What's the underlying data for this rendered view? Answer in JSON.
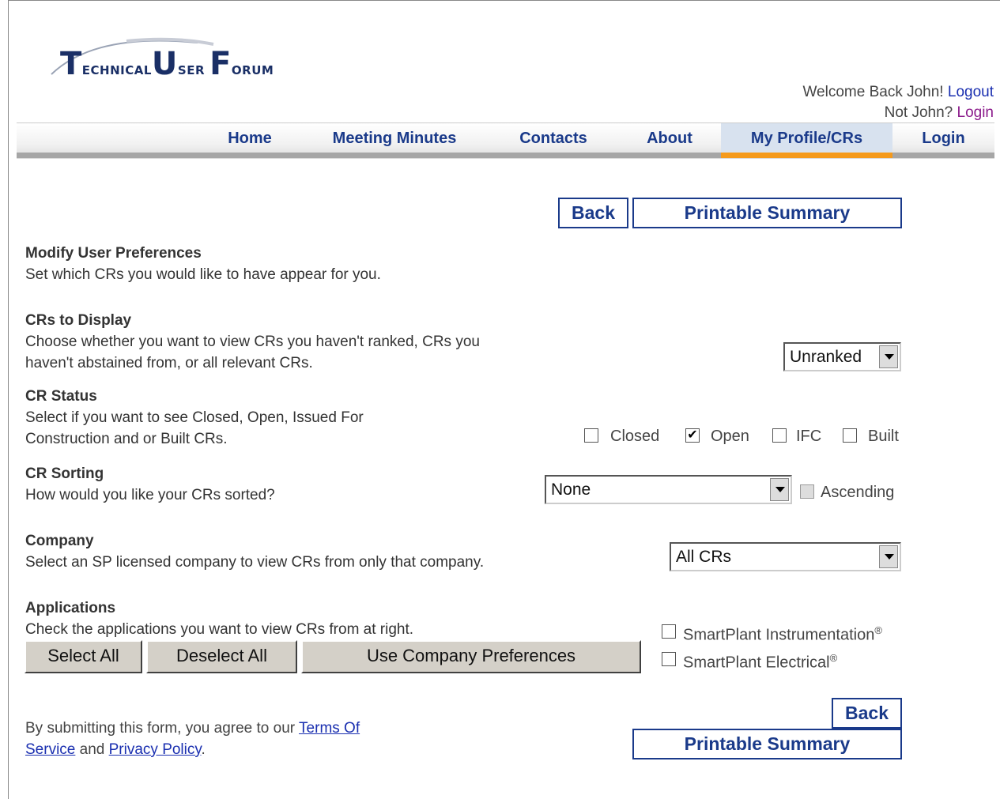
{
  "logo": {
    "text": "TECHNICAL USER FORUM",
    "t": "T",
    "t_rest": "ECHNICAL",
    "u": "U",
    "u_rest": "SER",
    "f": "F",
    "f_rest": "ORUM",
    "color": "#1a2f66"
  },
  "welcome": {
    "greeting": "Welcome Back John!",
    "logout": "Logout",
    "not_user": "Not John?",
    "login": "Login"
  },
  "nav": {
    "items": [
      "Home",
      "Meeting Minutes",
      "Contacts",
      "About",
      "My Profile/CRs",
      "Login"
    ],
    "active": "My Profile/CRs",
    "active_color": "#f59a1c"
  },
  "actions": {
    "back": "Back",
    "printable": "Printable Summary"
  },
  "prefs": {
    "title": "Modify User Preferences",
    "desc": "Set which CRs you would like to have appear for you."
  },
  "display": {
    "title": "CRs to Display",
    "desc1": "Choose whether you want to view CRs you haven't ranked, CRs you",
    "desc2": "haven't abstained from, or all relevant CRs.",
    "value": "Unranked"
  },
  "status": {
    "title": "CR Status",
    "desc1": "Select if you want to see Closed, Open, Issued For",
    "desc2": "Construction and or Built CRs.",
    "options": [
      {
        "label": "Closed",
        "checked": false
      },
      {
        "label": "Open",
        "checked": true
      },
      {
        "label": "IFC",
        "checked": false
      },
      {
        "label": "Built",
        "checked": false
      }
    ]
  },
  "sorting": {
    "title": "CR Sorting",
    "desc": "How would you like your CRs sorted?",
    "value": "None",
    "ascending": "Ascending"
  },
  "company": {
    "title": "Company",
    "desc": "Select an SP licensed company to view CRs from only that company.",
    "value": "All CRs"
  },
  "applications": {
    "title": "Applications",
    "desc": "Check the applications you want to view CRs from at right.",
    "select_all": "Select All",
    "deselect_all": "Deselect All",
    "use_company": "Use Company Preferences",
    "items": [
      {
        "label": "SmartPlant Instrumentation",
        "mark": "®"
      },
      {
        "label": "SmartPlant Electrical",
        "mark": "®"
      }
    ]
  },
  "footer": {
    "pre": "By submitting this form, you agree to our",
    "terms1": "Terms Of",
    "terms2": "Service",
    "and": "and",
    "privacy": "Privacy Policy",
    "end": "."
  }
}
